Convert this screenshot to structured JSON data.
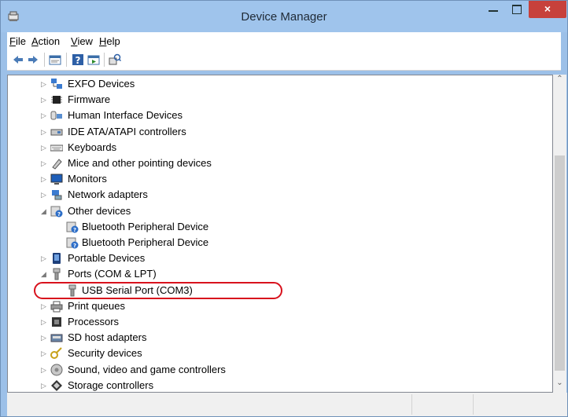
{
  "window": {
    "title": "Device Manager",
    "close_glyph": "×"
  },
  "menu": [
    {
      "label": "File",
      "key": "F",
      "rest": "ile"
    },
    {
      "label": "Action",
      "key": "A",
      "rest": "ction"
    },
    {
      "label": "View",
      "key": "V",
      "rest": "iew"
    },
    {
      "label": "Help",
      "key": "H",
      "rest": "elp"
    }
  ],
  "tree": [
    {
      "label": "EXFO Devices",
      "expanded": false,
      "icon": "network-devices-icon"
    },
    {
      "label": "Firmware",
      "expanded": false,
      "icon": "firmware-icon"
    },
    {
      "label": "Human Interface Devices",
      "expanded": false,
      "icon": "hid-icon"
    },
    {
      "label": "IDE ATA/ATAPI controllers",
      "expanded": false,
      "icon": "ide-controller-icon"
    },
    {
      "label": "Keyboards",
      "expanded": false,
      "icon": "keyboard-icon"
    },
    {
      "label": "Mice and other pointing devices",
      "expanded": false,
      "icon": "mouse-icon"
    },
    {
      "label": "Monitors",
      "expanded": false,
      "icon": "monitor-icon"
    },
    {
      "label": "Network adapters",
      "expanded": false,
      "icon": "network-adapter-icon"
    },
    {
      "label": "Other devices",
      "expanded": true,
      "icon": "unknown-device-icon",
      "children": [
        {
          "label": "Bluetooth Peripheral Device",
          "icon": "unknown-device-icon"
        },
        {
          "label": "Bluetooth Peripheral Device",
          "icon": "unknown-device-icon"
        }
      ]
    },
    {
      "label": "Portable Devices",
      "expanded": false,
      "icon": "portable-device-icon"
    },
    {
      "label": "Ports (COM & LPT)",
      "expanded": true,
      "icon": "port-icon",
      "children": [
        {
          "label": "USB Serial Port (COM3)",
          "icon": "port-icon",
          "highlighted": true
        }
      ]
    },
    {
      "label": "Print queues",
      "expanded": false,
      "icon": "printer-icon"
    },
    {
      "label": "Processors",
      "expanded": false,
      "icon": "processor-icon"
    },
    {
      "label": "SD host adapters",
      "expanded": false,
      "icon": "sd-adapter-icon"
    },
    {
      "label": "Security devices",
      "expanded": false,
      "icon": "security-key-icon"
    },
    {
      "label": "Sound, video and game controllers",
      "expanded": false,
      "icon": "sound-icon"
    },
    {
      "label": "Storage controllers",
      "expanded": false,
      "icon": "storage-icon"
    }
  ],
  "colors": {
    "title_bar": "#9fc4ec",
    "close_button": "#c7413b",
    "highlight_ring": "#d8121d"
  }
}
